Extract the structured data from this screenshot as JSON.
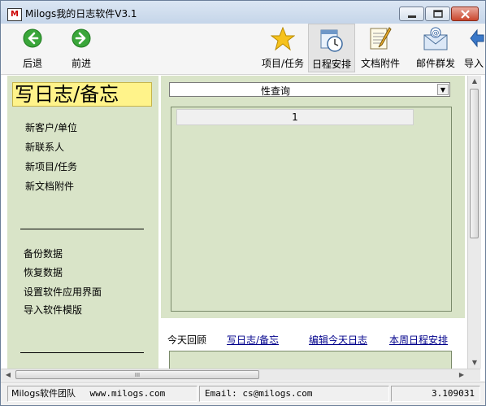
{
  "window": {
    "title": "Milogs我的日志软件V3.1",
    "icon_letter": "M"
  },
  "toolbar": {
    "back_label": "后退",
    "forward_label": "前进",
    "projects_label": "项目/任务",
    "schedule_label": "日程安排",
    "attachments_label": "文档附件",
    "mail_label": "邮件群发",
    "import_label": "导入"
  },
  "left_panel": {
    "write_button": "写日志/备忘",
    "new_items": [
      "新客户/单位",
      "新联系人",
      "新项目/任务",
      "新文档附件"
    ],
    "tools": [
      "备份数据",
      "恢复数据",
      "设置软件应用界面",
      "导入软件模版"
    ]
  },
  "query": {
    "combo_value": "性查询",
    "grid_header": "1"
  },
  "bottom_links": {
    "today_review": "今天回顾",
    "write_log": "写日志/备忘",
    "edit_today": "编辑今天日志",
    "week_schedule": "本周日程安排"
  },
  "scrollbar": {
    "grip": "III"
  },
  "status": {
    "team": "Milogs软件团队",
    "website": "www.milogs.com",
    "email": "Email:  cs@milogs.com",
    "version": "3.109031"
  },
  "colors": {
    "panel_green": "#d9e4c8",
    "write_button_yellow": "#fff38a",
    "link_blue": "#00008b"
  }
}
